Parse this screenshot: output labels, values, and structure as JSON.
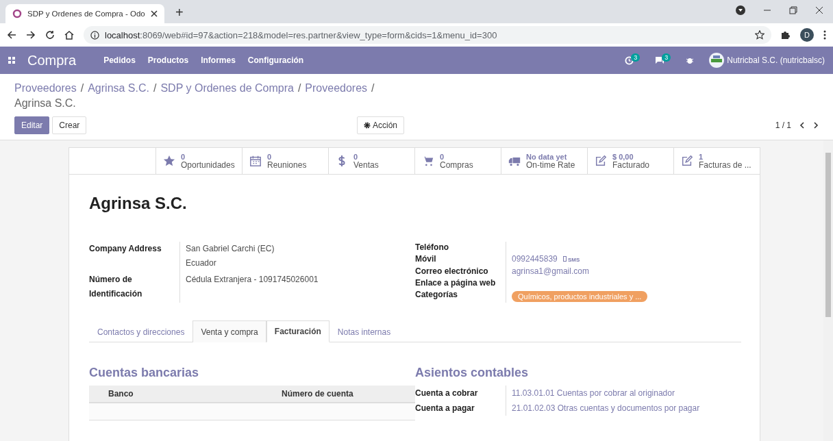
{
  "browser": {
    "tab_title": "SDP y Ordenes de Compra - Odo",
    "new_tab": "+",
    "url_host": "localhost",
    "url_rest": ":8069/web#id=97&action=218&model=res.partner&view_type=form&cids=1&menu_id=300",
    "profile": "D"
  },
  "navbar": {
    "app": "Compra",
    "menu": [
      "Pedidos",
      "Productos",
      "Informes",
      "Configuración"
    ],
    "activity_count": "3",
    "message_count": "3",
    "user": "Nutricbal S.C. (nutricbalsc)"
  },
  "breadcrumbs": {
    "separator": "/",
    "items": [
      {
        "label": "Proveedores"
      },
      {
        "label": "Agrinsa S.C."
      },
      {
        "label": "SDP y Ordenes de Compra"
      },
      {
        "label": "Proveedores"
      },
      {
        "label": "Agrinsa S.C."
      }
    ]
  },
  "buttons": {
    "edit": "Editar",
    "create": "Crear",
    "action": "Acción"
  },
  "pager": "1 / 1",
  "smart_buttons": [
    {
      "kind": "star",
      "value": "0",
      "label": "Oportunidades"
    },
    {
      "kind": "calendar",
      "value": "0",
      "label": "Reuniones"
    },
    {
      "kind": "dollar",
      "value": "0",
      "label": "Ventas"
    },
    {
      "kind": "cart",
      "value": "0",
      "label": "Compras"
    },
    {
      "kind": "truck",
      "value": "No data yet",
      "label": "On-time Rate"
    },
    {
      "kind": "edit",
      "value": "$ 0,00",
      "label": "Facturado"
    },
    {
      "kind": "edit",
      "value": "1",
      "label": "Facturas de ..."
    }
  ],
  "title": "Agrinsa S.C.",
  "left_fields": [
    {
      "label": "Company Address",
      "values": [
        "San Gabriel  Carchi (EC)",
        "Ecuador"
      ]
    },
    {
      "label": "Número de Identificación",
      "values": [
        "Cédula Extranjera - 1091745026001"
      ]
    }
  ],
  "right_fields": [
    {
      "label": "Teléfono"
    },
    {
      "label": "Móvil",
      "value": "0992445839",
      "sms": "SMS"
    },
    {
      "label": "Correo electrónico",
      "value": "agrinsa1@gmail.com"
    },
    {
      "label": "Enlace a página web"
    },
    {
      "label": "Categorías",
      "tag": "Químicos, productos industriales y ...",
      "color": "#f0a061"
    }
  ],
  "tabs": [
    {
      "label": "Contactos y direcciones",
      "selected": false
    },
    {
      "label": "Venta y compra",
      "selected": false
    },
    {
      "label": "Facturación",
      "selected": true
    },
    {
      "label": "Notas internas",
      "selected": false
    }
  ],
  "bank": {
    "heading": "Cuentas bancarias",
    "columns": [
      "Banco",
      "Número de cuenta"
    ]
  },
  "accounting": {
    "heading": "Asientos contables",
    "rows": [
      {
        "label": "Cuenta a cobrar",
        "value": "11.03.01.01 Cuentas por cobrar al originador"
      },
      {
        "label": "Cuenta a pagar",
        "value": "21.01.02.03 Otras cuentas y documentos por pagar"
      }
    ]
  }
}
